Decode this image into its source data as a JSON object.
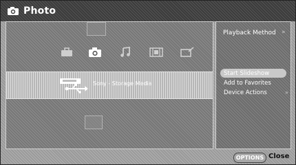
{
  "header": {
    "title": "Photo",
    "icon": "camera-icon"
  },
  "main": {
    "categories": [
      {
        "name": "briefcase-icon"
      },
      {
        "name": "camera-icon",
        "selected": true
      },
      {
        "name": "music-note-icon"
      },
      {
        "name": "film-icon"
      },
      {
        "name": "tv-edit-icon"
      }
    ],
    "selected_device": {
      "label": "Sony - Storage Media",
      "icon": "usb-storage-icon"
    }
  },
  "options_menu": {
    "heading": "Playback Method",
    "heading_arrow": "»",
    "items": [
      {
        "label": "Start Slideshow",
        "highlighted": true
      },
      {
        "label": "Add to Favorites"
      },
      {
        "label": "Device Actions",
        "arrow": "»"
      }
    ]
  },
  "footer": {
    "options_button": "OPTIONS",
    "close_label": "Close"
  },
  "colors": {
    "highlight": "#c9c9c9",
    "titlebar": "#3c3c3c"
  }
}
